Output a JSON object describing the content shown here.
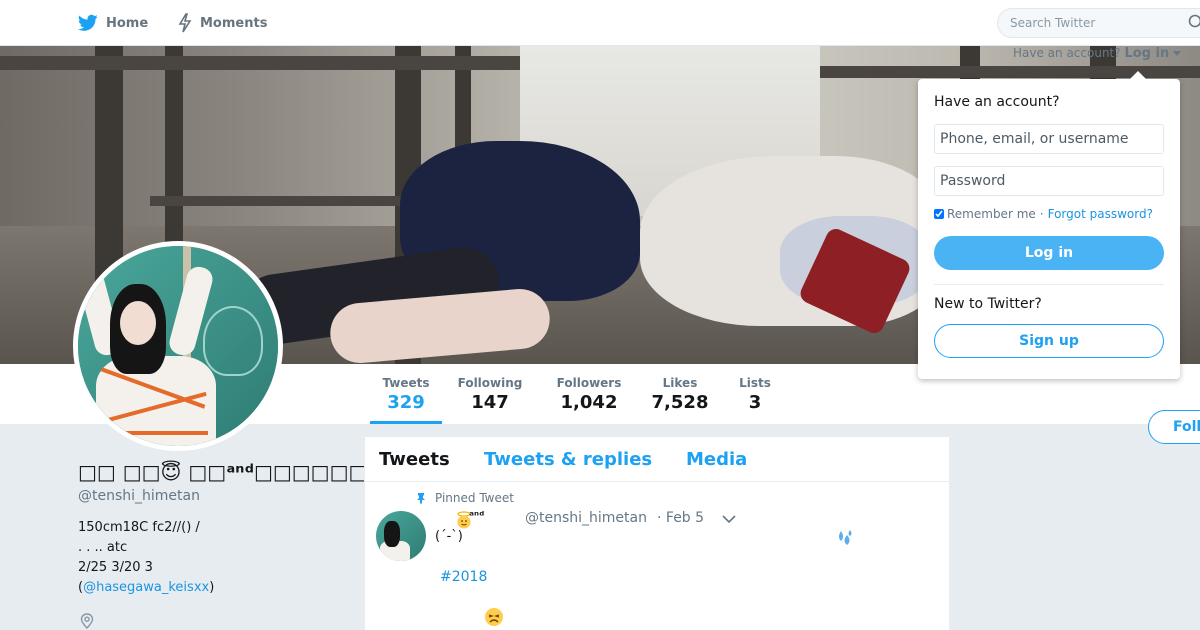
{
  "nav": {
    "home_label": "Home",
    "moments_label": "Moments",
    "search_placeholder": "Search Twitter"
  },
  "login_prompt": {
    "question": "Have an account?",
    "login_link": "Log in"
  },
  "login_panel": {
    "title": "Have an account?",
    "username_placeholder": "Phone, email, or username",
    "password_placeholder": "Password",
    "remember_label": "Remember me",
    "separator": "·",
    "forgot_label": "Forgot password?",
    "login_button": "Log in",
    "new_label": "New to Twitter?",
    "signup_button": "Sign up"
  },
  "profile_nav": {
    "stats": [
      {
        "label": "Tweets",
        "value": "329"
      },
      {
        "label": "Following",
        "value": "147"
      },
      {
        "label": "Followers",
        "value": "1,042"
      },
      {
        "label": "Likes",
        "value": "7,528"
      },
      {
        "label": "Lists",
        "value": "3"
      }
    ],
    "follow_button": "Foll"
  },
  "profile": {
    "name": "□□ □□😇 □□ᵃⁿᵈ□□□□□□□",
    "handle": "@tenshi_himetan",
    "bio_lines": [
      "150cm18C fc2//()  /",
      ". . .. atc",
      "2/25 3/20 3"
    ],
    "bio_link_prefix": "(",
    "bio_link": "@hasegawa_keisxx",
    "bio_link_suffix": ")"
  },
  "timeline": {
    "tabs": [
      "Tweets",
      "Tweets & replies",
      "Media"
    ],
    "pinned_label": "Pinned Tweet",
    "tweet": {
      "name_suffix": "ᵃⁿᵈ",
      "handle": "@tenshi_himetan",
      "date": "· Feb 5",
      "text": "(´-`)",
      "hashtag": "#2018"
    }
  },
  "colors": {
    "accent": "#1da1f2",
    "link": "#1b95e0",
    "login_button": "#4ab3f4",
    "background": "#e6ecf0"
  },
  "icons": [
    "twitter-bird-icon",
    "lightning-icon",
    "search-icon",
    "caret-down-icon",
    "pin-icon",
    "location-icon",
    "angel-emoji-icon",
    "sweat-emoji-icon",
    "tired-emoji-icon"
  ]
}
